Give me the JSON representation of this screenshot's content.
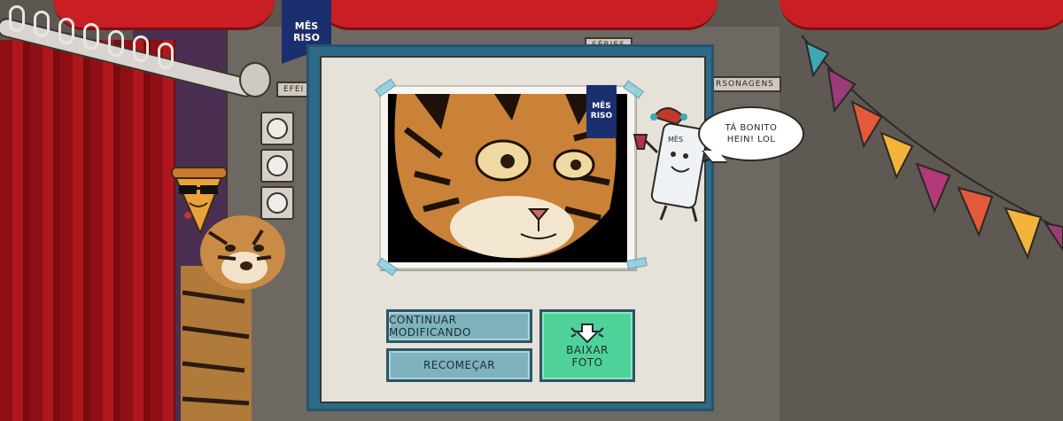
{
  "brand": {
    "line1": "MÊS",
    "line2": "RISO"
  },
  "wall_signs": {
    "effects": "EFEI",
    "series": "SÉRIES",
    "characters": "RSONAGENS"
  },
  "modal": {
    "photo_brand": {
      "line1": "MÊS",
      "line2": "RISO"
    },
    "speech_bubble": "TÁ BONITO HEIN! LOL",
    "buttons": {
      "continue_label": "CONTINUAR MODIFICANDO",
      "restart_label": "RECOMEÇAR",
      "download_label_1": "BAIXAR",
      "download_label_2": "FOTO"
    }
  },
  "colors": {
    "modal_border": "#2c6a88",
    "primary_button": "#4fd19a",
    "secondary_button": "#7fb2bf",
    "curtain": "#c81e24"
  }
}
